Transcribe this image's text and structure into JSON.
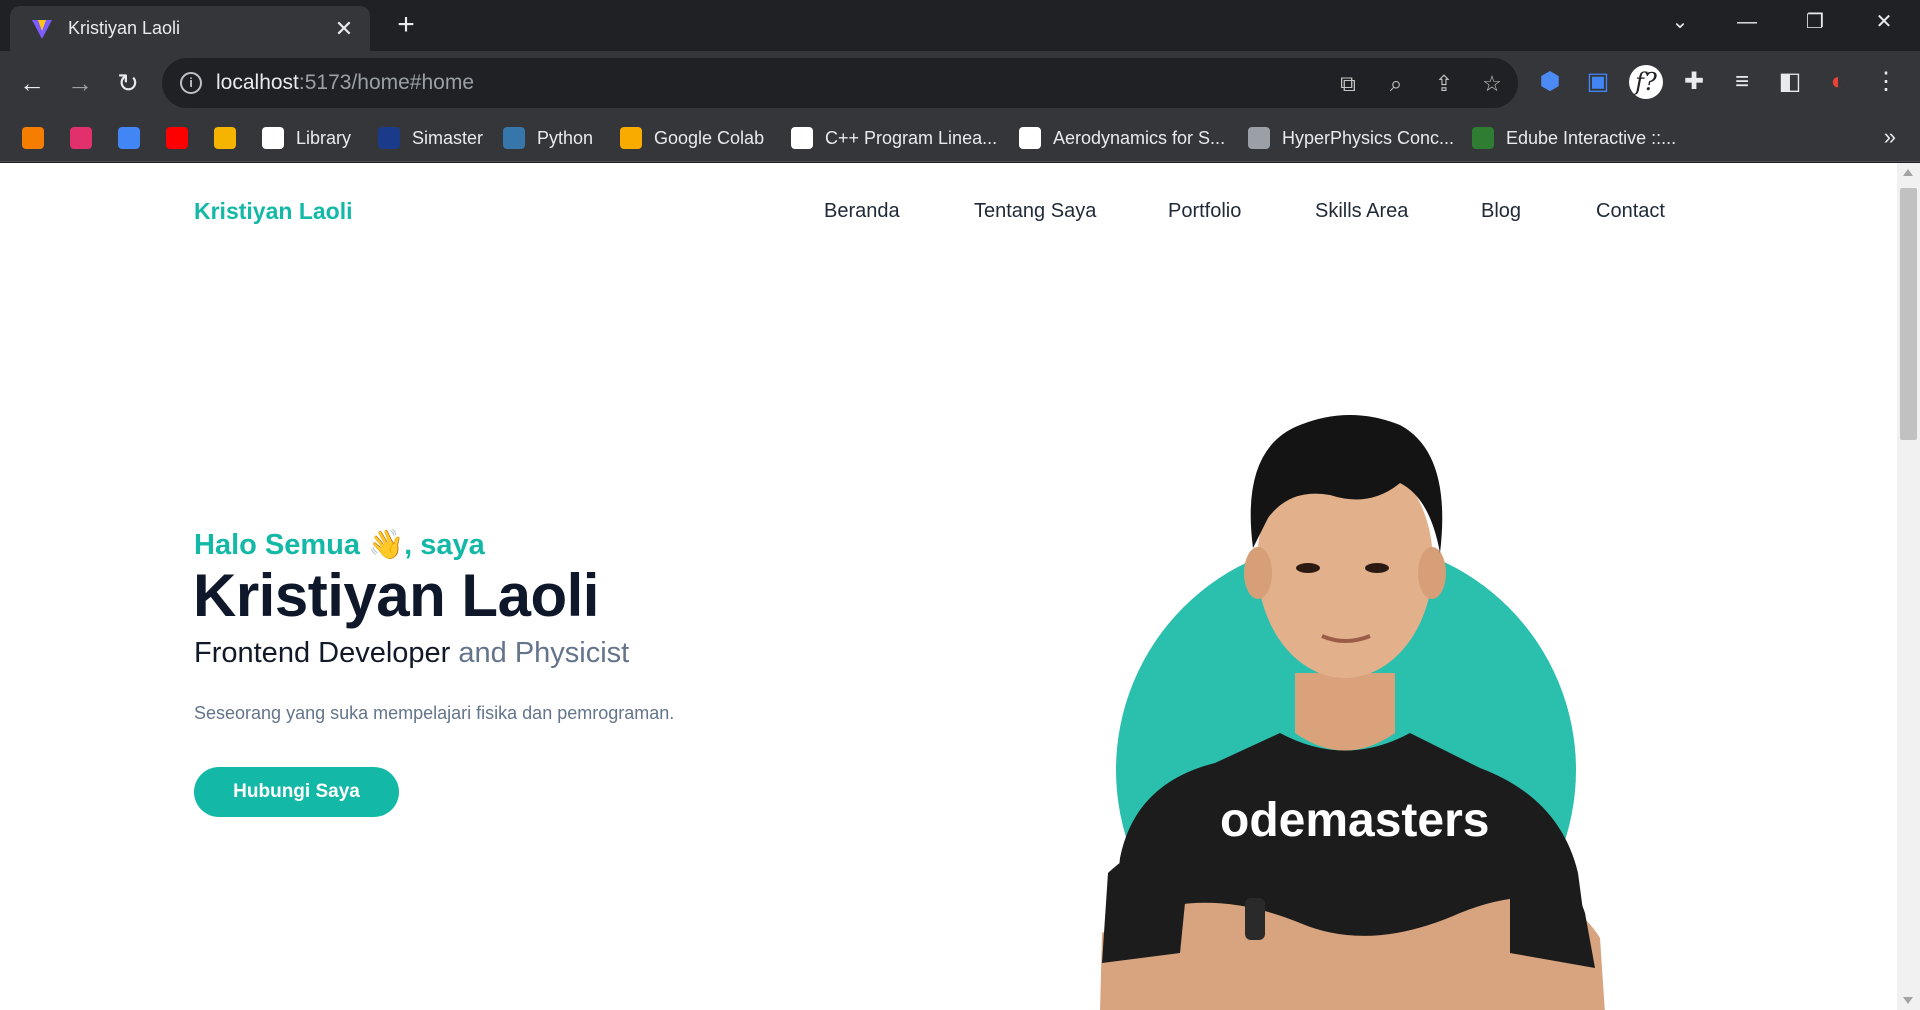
{
  "browser": {
    "tab_title": "Kristiyan Laoli",
    "new_tab_symbol": "+",
    "close_tab_symbol": "✕",
    "url_host": "localhost",
    "url_rest": ":5173/home#home",
    "bookmarks": [
      {
        "label": "",
        "icon": "blogger-icon",
        "color": "#f57d00"
      },
      {
        "label": "",
        "icon": "instagram-icon",
        "color": "#e1306c"
      },
      {
        "label": "",
        "icon": "translate-icon",
        "color": "#4285f4"
      },
      {
        "label": "",
        "icon": "youtube-icon",
        "color": "#ff0000"
      },
      {
        "label": "",
        "icon": "classroom-icon",
        "color": "#f4b400"
      },
      {
        "label": "Library",
        "icon": "library-icon",
        "color": "#ffffff"
      },
      {
        "label": "Simaster",
        "icon": "simaster-icon",
        "color": "#1a3a8a"
      },
      {
        "label": "Python",
        "icon": "python-icon",
        "color": "#3776ab"
      },
      {
        "label": "Google Colab",
        "icon": "colab-icon",
        "color": "#f9ab00"
      },
      {
        "label": "C++ Program Linea...",
        "icon": "cpp-icon",
        "color": "#ffffff"
      },
      {
        "label": "Aerodynamics for S...",
        "icon": "aero-icon",
        "color": "#ffffff"
      },
      {
        "label": "HyperPhysics Conc...",
        "icon": "globe-icon",
        "color": "#9aa0a6"
      },
      {
        "label": "Edube Interactive ::...",
        "icon": "edube-icon",
        "color": "#2e7d32"
      }
    ],
    "more_bookmarks": "»"
  },
  "site": {
    "brand": "Kristiyan Laoli",
    "nav": [
      "Beranda",
      "Tentang Saya",
      "Portfolio",
      "Skills Area",
      "Blog",
      "Contact"
    ],
    "greeting": "Halo Semua 👋, saya",
    "name": "Kristiyan Laoli",
    "role_main": "Frontend Developer",
    "role_extra": " and Physicist",
    "description": "Seseorang yang suka mempelajari fisika dan pemrograman.",
    "cta": "Hubungi Saya",
    "shirt_text": "odemasters",
    "accent_color": "#14b8a6",
    "heading_color": "#0f172a"
  }
}
